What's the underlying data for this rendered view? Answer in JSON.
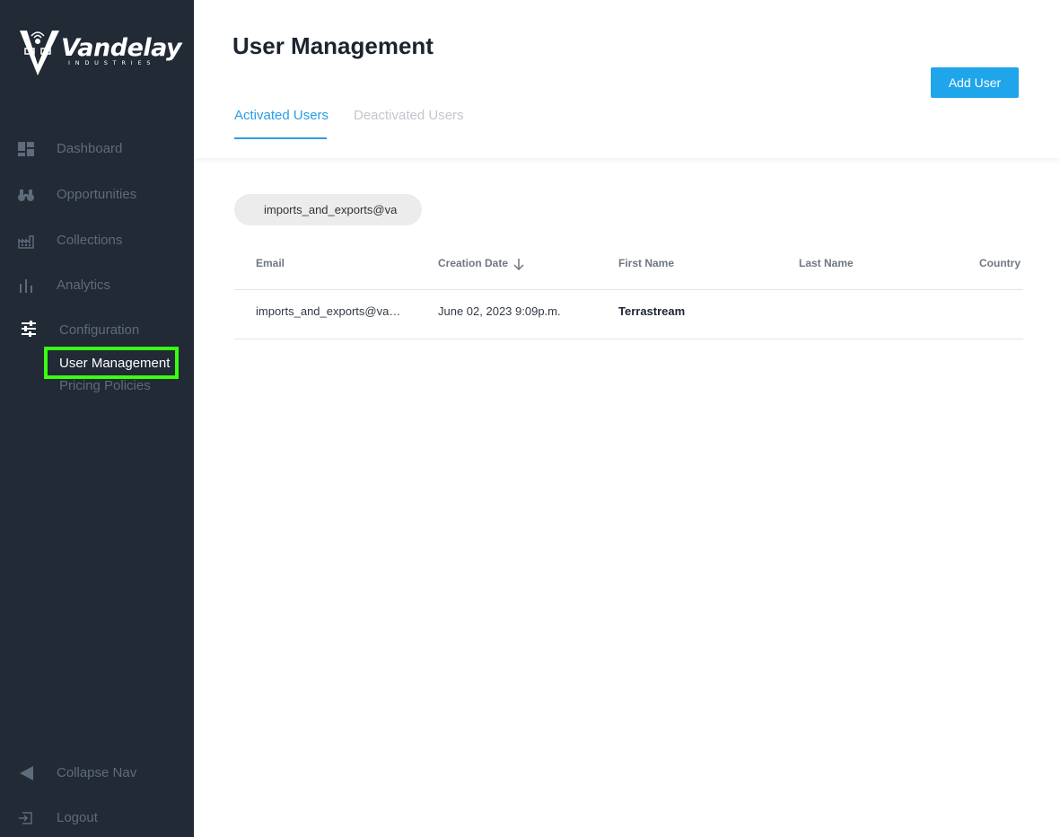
{
  "brand": {
    "name": "Vandelay",
    "tagline": "INDUSTRIES"
  },
  "sidebar": {
    "items": [
      {
        "label": "Dashboard",
        "icon": "dashboard-icon"
      },
      {
        "label": "Opportunities",
        "icon": "binoculars-icon"
      },
      {
        "label": "Collections",
        "icon": "factory-icon"
      },
      {
        "label": "Analytics",
        "icon": "bar-chart-icon"
      },
      {
        "label": "Configuration",
        "icon": "sliders-icon"
      }
    ],
    "sub_items": [
      {
        "label": "User Management",
        "active": true
      },
      {
        "label": "Pricing Policies",
        "active": false
      }
    ],
    "collapse_label": "Collapse Nav",
    "logout_label": "Logout"
  },
  "header": {
    "title": "User Management",
    "add_button": "Add User",
    "tabs": [
      {
        "label": "Activated Users",
        "active": true
      },
      {
        "label": "Deactivated Users",
        "active": false
      }
    ]
  },
  "search": {
    "value": "imports_and_exports@va"
  },
  "table": {
    "columns": [
      "Email",
      "Creation Date",
      "First Name",
      "Last Name",
      "Country"
    ],
    "sort_column": "Creation Date",
    "sort_direction": "descending",
    "rows": [
      {
        "email": "imports_and_exports@va…",
        "creation_date": "June 02, 2023 9:09p.m.",
        "first_name": "Terrastream",
        "last_name": "",
        "country": ""
      }
    ]
  },
  "colors": {
    "sidebar_bg": "#212a35",
    "accent": "#1fa5ea",
    "highlight": "#39ff14"
  }
}
